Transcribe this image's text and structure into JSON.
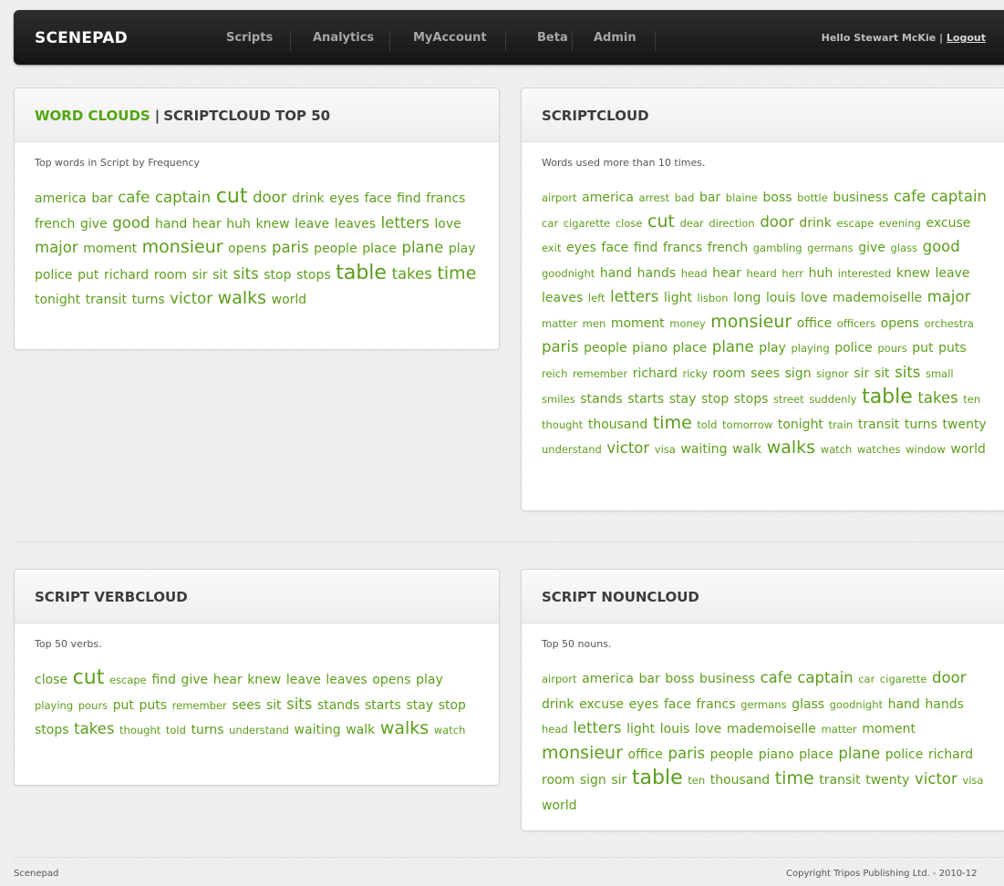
{
  "nav": {
    "brand": "SCENEPAD",
    "items": [
      "Scripts",
      "Analytics",
      "MyAccount",
      "Beta",
      "Admin"
    ],
    "greeting": "Hello Stewart McKie",
    "separator": "|",
    "logout": "Logout"
  },
  "colors": {
    "accent_green": "#52a510",
    "word_green": "#5b9e1b",
    "navbar": "#1c1c1c"
  },
  "panels": {
    "top50": {
      "title_green": "WORD CLOUDS",
      "title_separator": "|",
      "title_rest": "SCRIPTCLOUD TOP 50",
      "description": "Top words in Script by Frequency",
      "words": [
        [
          "america",
          2
        ],
        [
          "bar",
          2
        ],
        [
          "cafe",
          3
        ],
        [
          "captain",
          3
        ],
        [
          "cut",
          5
        ],
        [
          "door",
          3
        ],
        [
          "drink",
          2
        ],
        [
          "eyes",
          2
        ],
        [
          "face",
          2
        ],
        [
          "find",
          2
        ],
        [
          "francs",
          2
        ],
        [
          "french",
          2
        ],
        [
          "give",
          2
        ],
        [
          "good",
          3
        ],
        [
          "hand",
          2
        ],
        [
          "hear",
          2
        ],
        [
          "huh",
          2
        ],
        [
          "knew",
          2
        ],
        [
          "leave",
          2
        ],
        [
          "leaves",
          2
        ],
        [
          "letters",
          3
        ],
        [
          "love",
          2
        ],
        [
          "major",
          3
        ],
        [
          "moment",
          2
        ],
        [
          "monsieur",
          4
        ],
        [
          "opens",
          2
        ],
        [
          "paris",
          3
        ],
        [
          "people",
          2
        ],
        [
          "place",
          2
        ],
        [
          "plane",
          3
        ],
        [
          "play",
          2
        ],
        [
          "police",
          2
        ],
        [
          "put",
          2
        ],
        [
          "richard",
          2
        ],
        [
          "room",
          2
        ],
        [
          "sir",
          2
        ],
        [
          "sit",
          2
        ],
        [
          "sits",
          3
        ],
        [
          "stop",
          2
        ],
        [
          "stops",
          2
        ],
        [
          "table",
          5
        ],
        [
          "takes",
          3
        ],
        [
          "time",
          4
        ],
        [
          "tonight",
          2
        ],
        [
          "transit",
          2
        ],
        [
          "turns",
          2
        ],
        [
          "victor",
          3
        ],
        [
          "walks",
          4
        ],
        [
          "world",
          2
        ]
      ]
    },
    "scriptcloud": {
      "title": "SCRIPTCLOUD",
      "description": "Words used more than 10 times.",
      "words": [
        [
          "airport",
          1
        ],
        [
          "america",
          2
        ],
        [
          "arrest",
          1
        ],
        [
          "bad",
          1
        ],
        [
          "bar",
          2
        ],
        [
          "blaine",
          1
        ],
        [
          "boss",
          2
        ],
        [
          "bottle",
          1
        ],
        [
          "business",
          2
        ],
        [
          "cafe",
          3
        ],
        [
          "captain",
          3
        ],
        [
          "car",
          1
        ],
        [
          "cigarette",
          1
        ],
        [
          "close",
          1
        ],
        [
          "cut",
          4
        ],
        [
          "dear",
          1
        ],
        [
          "direction",
          1
        ],
        [
          "door",
          3
        ],
        [
          "drink",
          2
        ],
        [
          "escape",
          1
        ],
        [
          "evening",
          1
        ],
        [
          "excuse",
          2
        ],
        [
          "exit",
          1
        ],
        [
          "eyes",
          2
        ],
        [
          "face",
          2
        ],
        [
          "find",
          2
        ],
        [
          "francs",
          2
        ],
        [
          "french",
          2
        ],
        [
          "gambling",
          1
        ],
        [
          "germans",
          1
        ],
        [
          "give",
          2
        ],
        [
          "glass",
          1
        ],
        [
          "good",
          3
        ],
        [
          "goodnight",
          1
        ],
        [
          "hand",
          2
        ],
        [
          "hands",
          2
        ],
        [
          "head",
          1
        ],
        [
          "hear",
          2
        ],
        [
          "heard",
          1
        ],
        [
          "herr",
          1
        ],
        [
          "huh",
          2
        ],
        [
          "interested",
          1
        ],
        [
          "knew",
          2
        ],
        [
          "leave",
          2
        ],
        [
          "leaves",
          2
        ],
        [
          "left",
          1
        ],
        [
          "letters",
          3
        ],
        [
          "light",
          2
        ],
        [
          "lisbon",
          1
        ],
        [
          "long",
          2
        ],
        [
          "louis",
          2
        ],
        [
          "love",
          2
        ],
        [
          "mademoiselle",
          2
        ],
        [
          "major",
          3
        ],
        [
          "matter",
          1
        ],
        [
          "men",
          1
        ],
        [
          "moment",
          2
        ],
        [
          "money",
          1
        ],
        [
          "monsieur",
          4
        ],
        [
          "office",
          2
        ],
        [
          "officers",
          1
        ],
        [
          "opens",
          2
        ],
        [
          "orchestra",
          1
        ],
        [
          "paris",
          3
        ],
        [
          "people",
          2
        ],
        [
          "piano",
          2
        ],
        [
          "place",
          2
        ],
        [
          "plane",
          3
        ],
        [
          "play",
          2
        ],
        [
          "playing",
          1
        ],
        [
          "police",
          2
        ],
        [
          "pours",
          1
        ],
        [
          "put",
          2
        ],
        [
          "puts",
          2
        ],
        [
          "reich",
          1
        ],
        [
          "remember",
          1
        ],
        [
          "richard",
          2
        ],
        [
          "ricky",
          1
        ],
        [
          "room",
          2
        ],
        [
          "sees",
          2
        ],
        [
          "sign",
          2
        ],
        [
          "signor",
          1
        ],
        [
          "sir",
          2
        ],
        [
          "sit",
          2
        ],
        [
          "sits",
          3
        ],
        [
          "small",
          1
        ],
        [
          "smiles",
          1
        ],
        [
          "stands",
          2
        ],
        [
          "starts",
          2
        ],
        [
          "stay",
          2
        ],
        [
          "stop",
          2
        ],
        [
          "stops",
          2
        ],
        [
          "street",
          1
        ],
        [
          "suddenly",
          1
        ],
        [
          "table",
          5
        ],
        [
          "takes",
          3
        ],
        [
          "ten",
          1
        ],
        [
          "thought",
          1
        ],
        [
          "thousand",
          2
        ],
        [
          "time",
          4
        ],
        [
          "told",
          1
        ],
        [
          "tomorrow",
          1
        ],
        [
          "tonight",
          2
        ],
        [
          "train",
          1
        ],
        [
          "transit",
          2
        ],
        [
          "turns",
          2
        ],
        [
          "twenty",
          2
        ],
        [
          "understand",
          1
        ],
        [
          "victor",
          3
        ],
        [
          "visa",
          1
        ],
        [
          "waiting",
          2
        ],
        [
          "walk",
          2
        ],
        [
          "walks",
          4
        ],
        [
          "watch",
          1
        ],
        [
          "watches",
          1
        ],
        [
          "window",
          1
        ],
        [
          "world",
          2
        ]
      ]
    },
    "verbcloud": {
      "title": "SCRIPT VERBCLOUD",
      "description": "Top 50 verbs.",
      "words": [
        [
          "close",
          2
        ],
        [
          "cut",
          5
        ],
        [
          "escape",
          1
        ],
        [
          "find",
          2
        ],
        [
          "give",
          2
        ],
        [
          "hear",
          2
        ],
        [
          "knew",
          2
        ],
        [
          "leave",
          2
        ],
        [
          "leaves",
          2
        ],
        [
          "opens",
          2
        ],
        [
          "play",
          2
        ],
        [
          "playing",
          1
        ],
        [
          "pours",
          1
        ],
        [
          "put",
          2
        ],
        [
          "puts",
          2
        ],
        [
          "remember",
          1
        ],
        [
          "sees",
          2
        ],
        [
          "sit",
          2
        ],
        [
          "sits",
          3
        ],
        [
          "stands",
          2
        ],
        [
          "starts",
          2
        ],
        [
          "stay",
          2
        ],
        [
          "stop",
          2
        ],
        [
          "stops",
          2
        ],
        [
          "takes",
          3
        ],
        [
          "thought",
          1
        ],
        [
          "told",
          1
        ],
        [
          "turns",
          2
        ],
        [
          "understand",
          1
        ],
        [
          "waiting",
          2
        ],
        [
          "walk",
          2
        ],
        [
          "walks",
          4
        ],
        [
          "watch",
          1
        ]
      ]
    },
    "nouncloud": {
      "title": "SCRIPT NOUNCLOUD",
      "description": "Top 50 nouns.",
      "words": [
        [
          "airport",
          1
        ],
        [
          "america",
          2
        ],
        [
          "bar",
          2
        ],
        [
          "boss",
          2
        ],
        [
          "business",
          2
        ],
        [
          "cafe",
          3
        ],
        [
          "captain",
          3
        ],
        [
          "car",
          1
        ],
        [
          "cigarette",
          1
        ],
        [
          "door",
          3
        ],
        [
          "drink",
          2
        ],
        [
          "excuse",
          2
        ],
        [
          "eyes",
          2
        ],
        [
          "face",
          2
        ],
        [
          "francs",
          2
        ],
        [
          "germans",
          1
        ],
        [
          "glass",
          2
        ],
        [
          "goodnight",
          1
        ],
        [
          "hand",
          2
        ],
        [
          "hands",
          2
        ],
        [
          "head",
          1
        ],
        [
          "letters",
          3
        ],
        [
          "light",
          2
        ],
        [
          "louis",
          2
        ],
        [
          "love",
          2
        ],
        [
          "mademoiselle",
          2
        ],
        [
          "matter",
          1
        ],
        [
          "moment",
          2
        ],
        [
          "monsieur",
          4
        ],
        [
          "office",
          2
        ],
        [
          "paris",
          3
        ],
        [
          "people",
          2
        ],
        [
          "piano",
          2
        ],
        [
          "place",
          2
        ],
        [
          "plane",
          3
        ],
        [
          "police",
          2
        ],
        [
          "richard",
          2
        ],
        [
          "room",
          2
        ],
        [
          "sign",
          2
        ],
        [
          "sir",
          2
        ],
        [
          "table",
          5
        ],
        [
          "ten",
          1
        ],
        [
          "thousand",
          2
        ],
        [
          "time",
          4
        ],
        [
          "transit",
          2
        ],
        [
          "twenty",
          2
        ],
        [
          "victor",
          3
        ],
        [
          "visa",
          1
        ],
        [
          "world",
          2
        ]
      ]
    }
  },
  "footer": {
    "left": "Scenepad",
    "right": "Copyright Tripos Publishing Ltd. - 2010-12"
  }
}
